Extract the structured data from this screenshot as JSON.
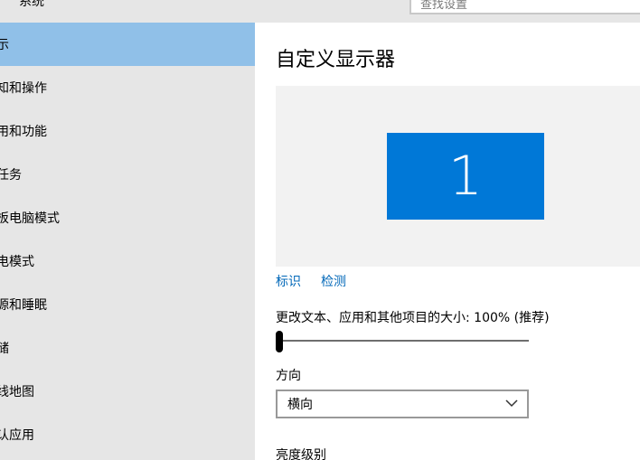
{
  "window": {
    "app_title": "系统",
    "search_placeholder": "查找设置"
  },
  "sidebar": {
    "items": [
      {
        "label": "显示",
        "visible_text": "示",
        "selected": true
      },
      {
        "label": "通知和操作",
        "visible_text": "知和操作"
      },
      {
        "label": "应用和功能",
        "visible_text": "用和功能"
      },
      {
        "label": "多任务",
        "visible_text": "任务"
      },
      {
        "label": "平板电脑模式",
        "visible_text": "板电脑模式"
      },
      {
        "label": "节电模式",
        "visible_text": "电模式"
      },
      {
        "label": "电源和睡眠",
        "visible_text": "源和睡眠"
      },
      {
        "label": "存储",
        "visible_text": "储"
      },
      {
        "label": "离线地图",
        "visible_text": "线地图"
      },
      {
        "label": "默认应用",
        "visible_text": "认应用"
      }
    ]
  },
  "main": {
    "title": "自定义显示器",
    "monitor_number": "1",
    "identify_link": "标识",
    "detect_link": "检测",
    "scale_label": "更改文本、应用和其他项目的大小: 100% (推荐)",
    "scale_value_percent": 100,
    "scale_slider_fraction": 0,
    "orientation_label": "方向",
    "orientation_value": "横向",
    "brightness_label": "亮度级别"
  },
  "colors": {
    "sidebar_bg": "#e6e6e6",
    "selected_bg": "#90c0e8",
    "accent": "#0078d7",
    "link": "#0067b8"
  }
}
